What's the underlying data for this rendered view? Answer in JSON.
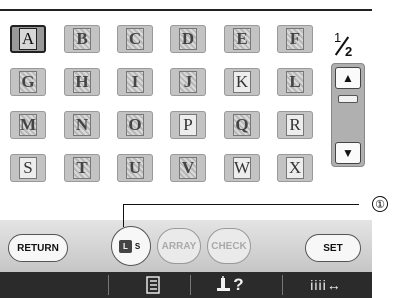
{
  "grid": {
    "tiles": [
      {
        "label": "A",
        "ornate": false,
        "selected": true
      },
      {
        "label": "B",
        "ornate": true,
        "selected": false
      },
      {
        "label": "C",
        "ornate": true,
        "selected": false
      },
      {
        "label": "D",
        "ornate": true,
        "selected": false
      },
      {
        "label": "E",
        "ornate": true,
        "selected": false
      },
      {
        "label": "F",
        "ornate": true,
        "selected": false
      },
      {
        "label": "G",
        "ornate": true,
        "selected": false
      },
      {
        "label": "H",
        "ornate": true,
        "selected": false
      },
      {
        "label": "I",
        "ornate": true,
        "selected": false
      },
      {
        "label": "J",
        "ornate": true,
        "selected": false
      },
      {
        "label": "K",
        "ornate": false,
        "selected": false
      },
      {
        "label": "L",
        "ornate": true,
        "selected": false
      },
      {
        "label": "M",
        "ornate": true,
        "selected": false
      },
      {
        "label": "N",
        "ornate": true,
        "selected": false
      },
      {
        "label": "O",
        "ornate": true,
        "selected": false
      },
      {
        "label": "P",
        "ornate": false,
        "selected": false
      },
      {
        "label": "Q",
        "ornate": true,
        "selected": false
      },
      {
        "label": "R",
        "ornate": false,
        "selected": false
      },
      {
        "label": "S",
        "ornate": false,
        "selected": false
      },
      {
        "label": "T",
        "ornate": true,
        "selected": false
      },
      {
        "label": "U",
        "ornate": true,
        "selected": false
      },
      {
        "label": "V",
        "ornate": true,
        "selected": false
      },
      {
        "label": "W",
        "ornate": false,
        "selected": false
      },
      {
        "label": "X",
        "ornate": false,
        "selected": false
      }
    ]
  },
  "pager": {
    "current": "1",
    "total": "2"
  },
  "scroll": {
    "up_icon": "▲",
    "down_icon": "▼"
  },
  "buttons": {
    "return": "RETURN",
    "ls_l": "L",
    "ls_s": "S",
    "array": "ARRAY",
    "check": "CHECK",
    "set": "SET"
  },
  "callout": {
    "number": "①"
  },
  "toolbar": {
    "help": "?",
    "spacing": "iiii↔"
  }
}
